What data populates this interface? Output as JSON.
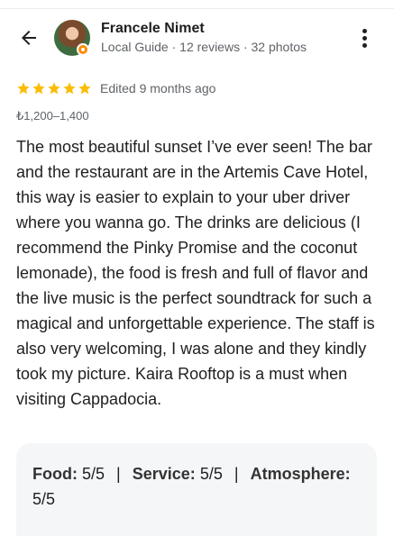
{
  "reviewer": {
    "name": "Francele Nimet",
    "meta": "Local Guide · 12 reviews · 32 photos"
  },
  "icons": {
    "back": "arrow-left-icon",
    "more": "more-vert-icon",
    "star": "star-icon",
    "badge": "local-guide-badge-icon"
  },
  "colors": {
    "star": "#fbbc04",
    "badge": "#ff8a00",
    "text": "#1f1f1f",
    "secondary": "#5f6368",
    "card": "#f5f6f8"
  },
  "rating": {
    "stars": 5,
    "edited": "Edited 9 months ago"
  },
  "price": "₺1,200–1,400",
  "review_text": "The most beautiful sunset I’ve ever seen! The bar and the restaurant are in the Artemis Cave Hotel, this way is easier to explain to your uber driver where you wanna go. The drinks are delicious (I recommend the Pinky Promise and the coconut lemonade), the food is fresh and full of flavor and the live music is the perfect soundtrack for such a magical and unforgettable experience. The staff is also very welcoming, I was alone and they kindly took my picture. Kaira Rooftop is a must when visiting Cappadocia.",
  "attributes": {
    "food_label": "Food:",
    "food_value": "5/5",
    "service_label": "Service:",
    "service_value": "5/5",
    "atmosphere_label": "Atmosphere:",
    "atmosphere_value": "5/5",
    "separator": "|"
  }
}
